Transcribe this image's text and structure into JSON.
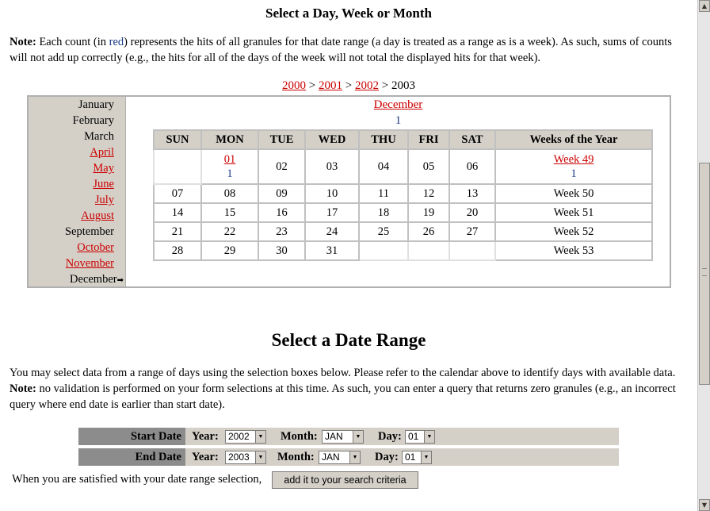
{
  "calendar_section": {
    "title": "Select a Day, Week or Month",
    "note_label": "Note:",
    "note_part1": "Each count (in",
    "note_red": "red",
    "note_part2": ") represents the hits of all granules for that date range (a day is treated as a range as is a week). As such, sums of counts will not add up correctly (e.g., the hits for all of the days of the week will not total the displayed hits for that week).",
    "years": [
      {
        "label": "2000",
        "link": true
      },
      {
        "label": "2001",
        "link": true
      },
      {
        "label": "2002",
        "link": true
      },
      {
        "label": "2003",
        "link": false
      }
    ],
    "year_separator": ">",
    "months": [
      {
        "label": "January",
        "link": false
      },
      {
        "label": "February",
        "link": false
      },
      {
        "label": "March",
        "link": false
      },
      {
        "label": "April",
        "link": true
      },
      {
        "label": "May",
        "link": true
      },
      {
        "label": "June",
        "link": true
      },
      {
        "label": "July",
        "link": true
      },
      {
        "label": "August",
        "link": true
      },
      {
        "label": "September",
        "link": false
      },
      {
        "label": "October",
        "link": true
      },
      {
        "label": "November",
        "link": true
      },
      {
        "label": "December",
        "link": false,
        "current": true
      }
    ],
    "current_month": "December",
    "current_month_count": "1",
    "day_headers": [
      "SUN",
      "MON",
      "TUE",
      "WED",
      "THU",
      "FRI",
      "SAT",
      "Weeks of the Year"
    ],
    "weeks": [
      {
        "days": [
          "",
          "01",
          "02",
          "03",
          "04",
          "05",
          "06"
        ],
        "day_counts": [
          "",
          "1",
          "",
          "",
          "",
          "",
          ""
        ],
        "week": "Week 49",
        "week_link": true,
        "week_count": "1"
      },
      {
        "days": [
          "07",
          "08",
          "09",
          "10",
          "11",
          "12",
          "13"
        ],
        "day_counts": [
          "",
          "",
          "",
          "",
          "",
          "",
          ""
        ],
        "week": "Week 50",
        "week_link": false,
        "week_count": ""
      },
      {
        "days": [
          "14",
          "15",
          "16",
          "17",
          "18",
          "19",
          "20"
        ],
        "day_counts": [
          "",
          "",
          "",
          "",
          "",
          "",
          ""
        ],
        "week": "Week 51",
        "week_link": false,
        "week_count": ""
      },
      {
        "days": [
          "21",
          "22",
          "23",
          "24",
          "25",
          "26",
          "27"
        ],
        "day_counts": [
          "",
          "",
          "",
          "",
          "",
          "",
          ""
        ],
        "week": "Week 52",
        "week_link": false,
        "week_count": ""
      },
      {
        "days": [
          "28",
          "29",
          "30",
          "31",
          "",
          "",
          ""
        ],
        "day_counts": [
          "",
          "",
          "",
          "",
          "",
          "",
          ""
        ],
        "week": "Week 53",
        "week_link": false,
        "week_count": ""
      }
    ],
    "linked_days": [
      "01"
    ]
  },
  "range_section": {
    "title": "Select a Date Range",
    "desc_part1": "You may select data from a range of days using the selection boxes below. Please refer to the calendar above to identify days with available data.",
    "desc_note_label": "Note:",
    "desc_part2": "no validation is performed on your form selections at this time. As such, you can enter a query that returns zero granules (e.g., an incorrect query where end date is earlier than start date).",
    "start": {
      "label": "Start Date",
      "year_label": "Year:",
      "year": "2002",
      "month_label": "Month:",
      "month": "JAN",
      "day_label": "Day:",
      "day": "01"
    },
    "end": {
      "label": "End Date",
      "year_label": "Year:",
      "year": "2003",
      "month_label": "Month:",
      "month": "JAN",
      "day_label": "Day:",
      "day": "01"
    },
    "satisfied_text": "When you are satisfied with your date range selection,",
    "add_button": "add it to your search criteria"
  },
  "icons": {
    "dropdown": "chevron-down-icon",
    "month_pointer": "arrow-right-icon",
    "scroll_up": "arrow-up-icon",
    "scroll_down": "arrow-down-icon"
  }
}
